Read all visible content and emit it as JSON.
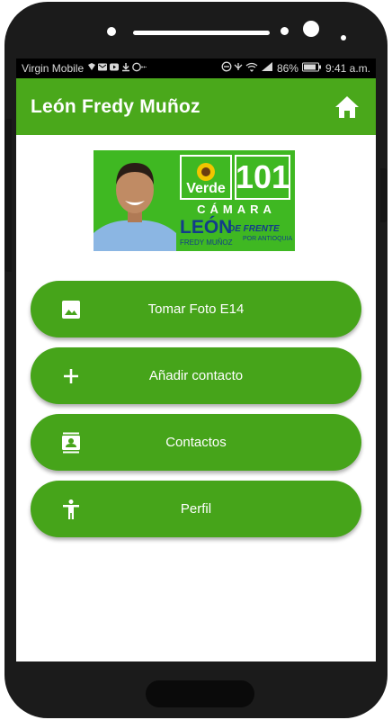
{
  "status_bar": {
    "carrier": "Virgin Mobile",
    "battery": "86%",
    "time": "9:41 a.m."
  },
  "app_bar": {
    "title": "León Fredy Muñoz",
    "home_icon": "home-icon"
  },
  "banner": {
    "party": "Verde",
    "number": "101",
    "chamber": "CÁMARA",
    "candidate_first": "LEÓN",
    "candidate_full": "FREDY MUÑOZ",
    "slogan": "DE FRENTE",
    "slogan_sub": "POR ANTIOQUIA"
  },
  "menu": [
    {
      "label": "Tomar Foto E14",
      "icon": "image-icon"
    },
    {
      "label": "Añadir contacto",
      "icon": "plus-icon"
    },
    {
      "label": "Contactos",
      "icon": "contacts-icon"
    },
    {
      "label": "Perfil",
      "icon": "person-icon"
    }
  ],
  "colors": {
    "primary": "#4aa81b",
    "button": "#46a41a",
    "status_bar": "#000000",
    "phone_frame": "#1b1b1b"
  }
}
